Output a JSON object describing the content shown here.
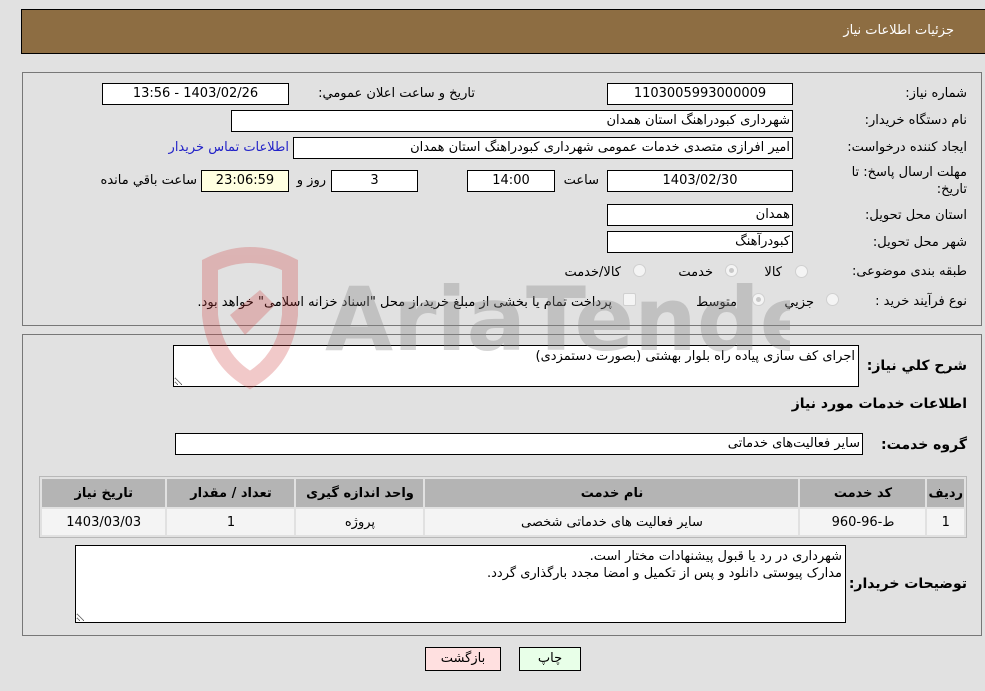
{
  "header": {
    "title": "جزئیات اطلاعات نیاز"
  },
  "fields": {
    "need_number_label": "شماره نیاز:",
    "need_number": "1103005993000009",
    "announce_label": "تاریخ و ساعت اعلان عمومي:",
    "announce_value": "1403/02/26 - 13:56",
    "buyer_org_label": "نام دستگاه خریدار:",
    "buyer_org": "شهرداری کبودراهنگ استان همدان",
    "creator_label": "ایجاد کننده درخواست:",
    "creator": "امیر افرازی متصدی خدمات عمومی شهرداری کبودراهنگ استان همدان",
    "contact_link": "اطلاعات تماس خریدار",
    "deadline_label_line1": "مهلت ارسال پاسخ: تا",
    "deadline_label_line2": "تاریخ:",
    "deadline_date": "1403/02/30",
    "time_label": "ساعت",
    "deadline_time": "14:00",
    "days": "3",
    "days_label": "روز و",
    "remaining_time": "23:06:59",
    "remaining_label": "ساعت باقي مانده",
    "province_label": "استان محل تحویل:",
    "province": "همدان",
    "city_label": "شهر محل تحویل:",
    "city": "کبودرآهنگ",
    "category_label": "طبقه بندی موضوعی:",
    "category_options": [
      "کالا",
      "خدمت",
      "کالا/خدمت"
    ],
    "category_selected": "خدمت",
    "process_label": "نوع فرآیند خرید :",
    "process_options": [
      "جزيي",
      "متوسط"
    ],
    "process_selected": "متوسط",
    "treasury_note": "پرداخت تمام یا بخشی از مبلغ خرید،از محل \"اسناد خزانه اسلامی\" خواهد بود."
  },
  "details": {
    "description_label": "شرح كلي نياز:",
    "description": "اجرای کف سازی پیاده راه بلوار بهشتی (بصورت دستمزدی)",
    "services_heading": "اطلاعات خدمات مورد نیاز",
    "service_group_label": "گروه خدمت:",
    "service_group": "سایر فعالیت‌های خدماتی",
    "table": {
      "headers": [
        "ردیف",
        "کد خدمت",
        "نام خدمت",
        "واحد اندازه گیری",
        "تعداد / مقدار",
        "تاریخ نیاز"
      ],
      "rows": [
        [
          "1",
          "ط-96-960",
          "سایر فعالیت های خدماتی شخصی",
          "پروژه",
          "1",
          "1403/03/03"
        ]
      ]
    },
    "buyer_notes_label": "توضیحات خریدار:",
    "buyer_notes": "شهرداری در رد یا قبول پیشنهادات مختار است.\nمدارک پیوستی دانلود و پس از تکمیل و امضا مجدد بارگذاری گردد."
  },
  "buttons": {
    "print": "چاپ",
    "back": "بازگشت"
  },
  "watermark": {
    "text": "AriaTender.neT"
  }
}
